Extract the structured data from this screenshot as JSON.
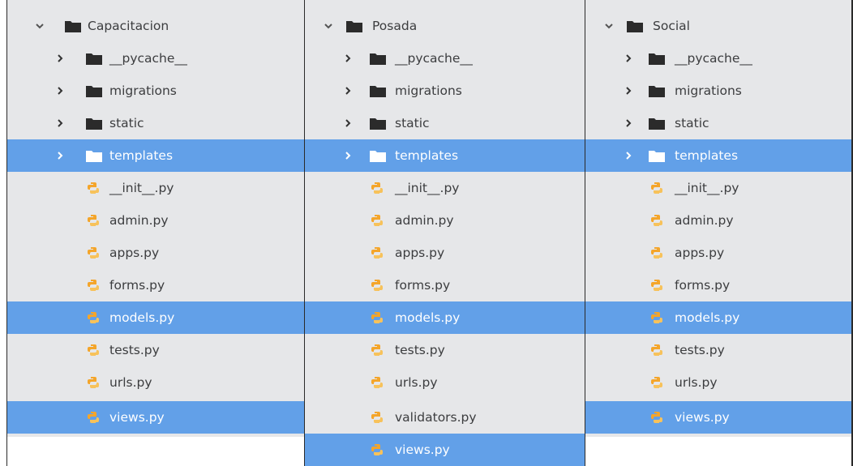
{
  "colors": {
    "panel_bg": "#e6e7e9",
    "selection": "#62a0e8",
    "text": "#3c3d3f",
    "folder": "#2b2b2b",
    "python_orange": "#f4a52a"
  },
  "panels": [
    {
      "root": "Capacitacion",
      "items": [
        "__pycache__",
        "migrations",
        "static",
        "templates",
        "__init__.py",
        "admin.py",
        "apps.py",
        "forms.py",
        "models.py",
        "tests.py",
        "urls.py",
        "views.py"
      ]
    },
    {
      "root": "Posada",
      "items": [
        "__pycache__",
        "migrations",
        "static",
        "templates",
        "__init__.py",
        "admin.py",
        "apps.py",
        "forms.py",
        "models.py",
        "tests.py",
        "urls.py",
        "validators.py",
        "views.py"
      ]
    },
    {
      "root": "Social",
      "items": [
        "__pycache__",
        "migrations",
        "static",
        "templates",
        "__init__.py",
        "admin.py",
        "apps.py",
        "forms.py",
        "models.py",
        "tests.py",
        "urls.py",
        "views.py"
      ]
    }
  ]
}
